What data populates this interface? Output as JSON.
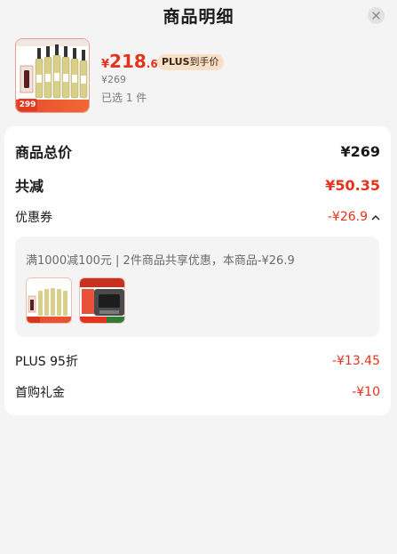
{
  "header": {
    "title": "商品明细"
  },
  "product": {
    "thumb_badge_price": "299",
    "price_currency": "¥",
    "price_integer": "218",
    "price_decimal": ".65",
    "plus_brand": "PLUS",
    "plus_label": "到手价",
    "original_price": "¥269",
    "selected_count": "已选 1 件"
  },
  "summary": {
    "total_label": "商品总价",
    "total_value": "¥269",
    "reduce_label": "共减",
    "reduce_value": "¥50.35",
    "coupon_label": "优惠券",
    "coupon_value": "-¥26.9",
    "coupon_detail": "满1000减100元 | 2件商品共享优惠，本商品-¥26.9",
    "plus_discount_label": "PLUS 95折",
    "plus_discount_value": "-¥13.45",
    "first_gift_label": "首购礼金",
    "first_gift_value": "-¥10"
  },
  "colors": {
    "accent_red": "#e4321d",
    "plus_tag_bg": "#f8dfc5"
  },
  "icons": {
    "close": "close-icon",
    "chevron": "chevron-up-icon"
  }
}
